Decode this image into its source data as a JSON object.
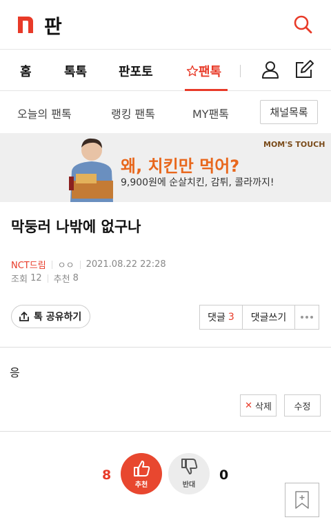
{
  "header": {
    "brand": "판",
    "colors": {
      "accent": "#e83a28"
    }
  },
  "nav": {
    "items": [
      {
        "label": "홈"
      },
      {
        "label": "톡톡"
      },
      {
        "label": "판포토"
      },
      {
        "label": "팬톡",
        "active": true
      }
    ],
    "icons": [
      "profile-icon",
      "write-icon"
    ]
  },
  "subnav": {
    "items": [
      {
        "label": "오늘의 팬톡"
      },
      {
        "label": "랭킹 팬톡"
      },
      {
        "label": "MY팬톡"
      }
    ],
    "channel_button": "채널목록"
  },
  "ad": {
    "headline": "왜, 치킨만 먹어?",
    "subtext": "9,900원에 순살치킨, 감튀, 콜라까지!",
    "brand": "MOM'S TOUCH"
  },
  "post": {
    "title": "막둥러 나밖에 없구나",
    "author": "NCT드림",
    "nickname": "ㅇㅇ",
    "datetime": "2021.08.22 22:28",
    "views_label": "조회",
    "views": "12",
    "recommend_label": "추천",
    "recommend": "8",
    "body": "응"
  },
  "actions": {
    "share_label": "톡 공유하기",
    "comments_label": "댓글",
    "comments_count": "3",
    "write_comment_label": "댓글쓰기",
    "delete_label": "삭제",
    "edit_label": "수정"
  },
  "vote": {
    "up_count": "8",
    "up_label": "추천",
    "down_count": "0",
    "down_label": "반대"
  }
}
